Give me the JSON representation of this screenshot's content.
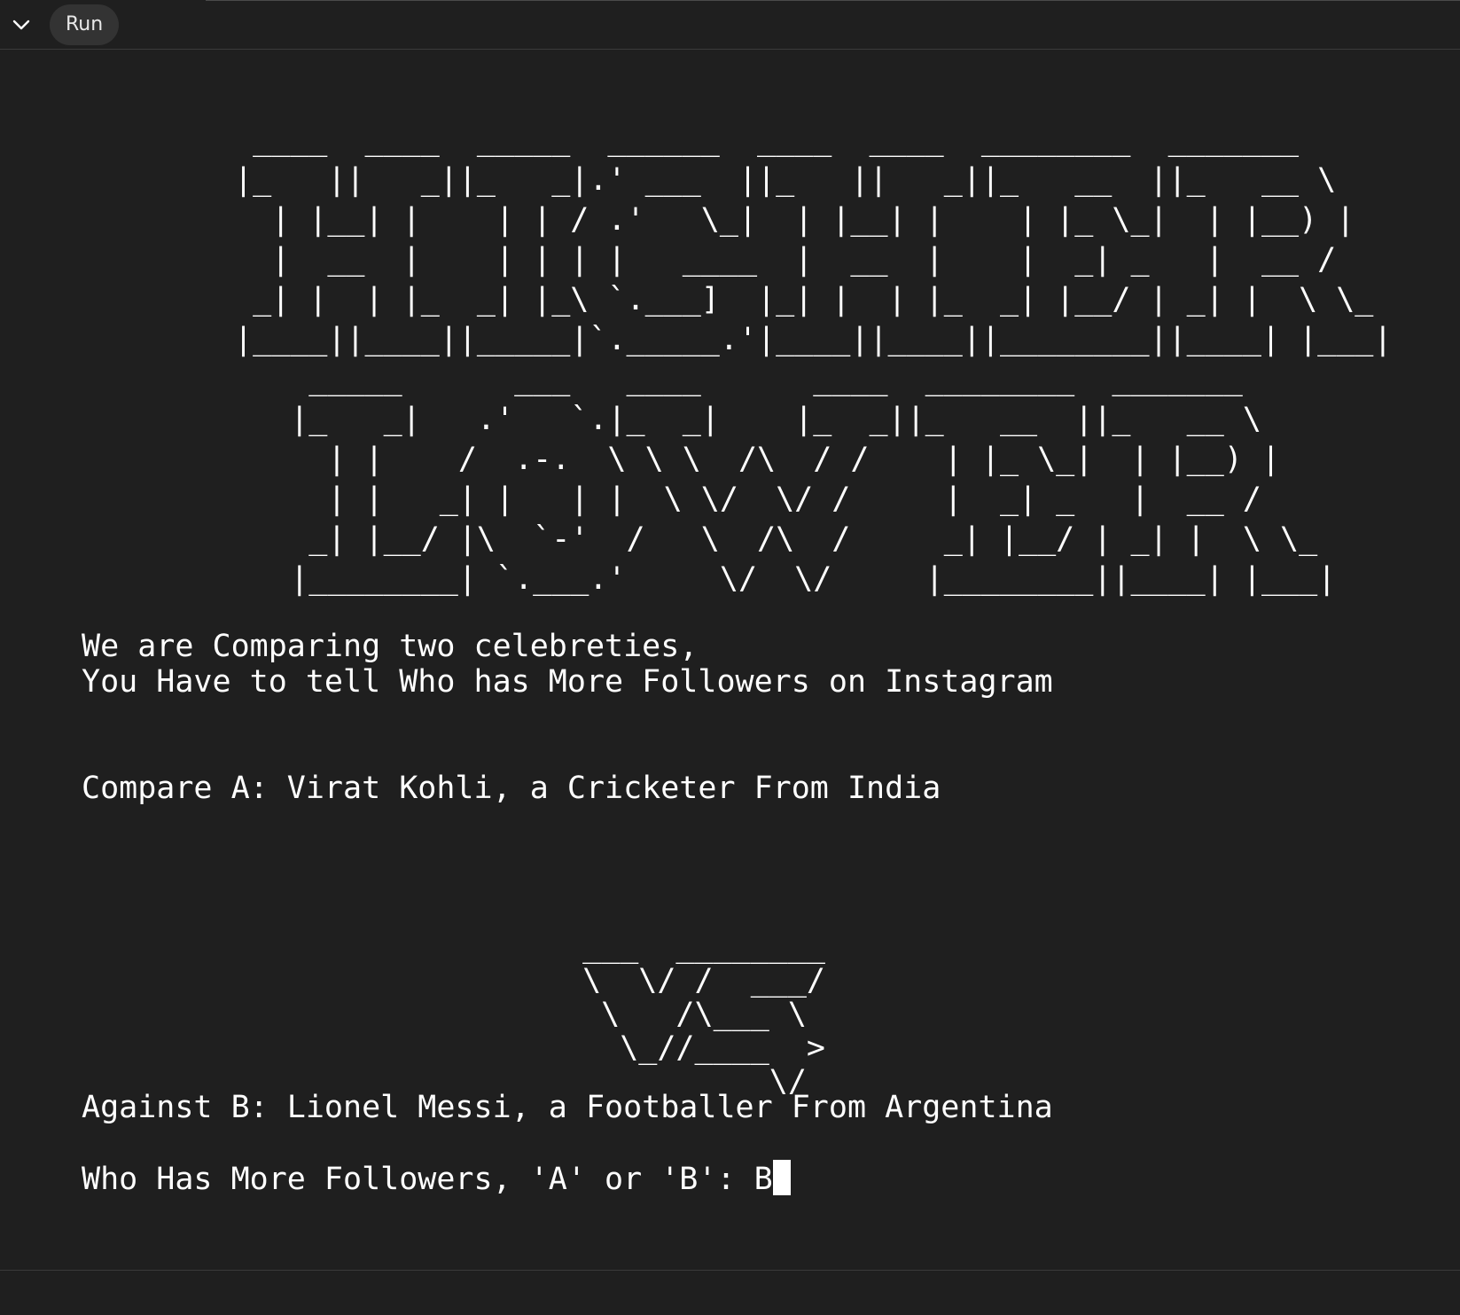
{
  "toolbar": {
    "collapse_icon": "chevron-down-icon",
    "run_label": "Run"
  },
  "console": {
    "ascii_title": " ____  ____  _____  ______  ____  ____  ________  _______\n|_   ||   _||_   _|.' ___  ||_   ||   _||_   __  ||_   __ \\\n  | |__| |    | | / .'   \\_|  | |__| |    | |_ \\_|  | |__) |\n  |  __  |    | | | |   ____  |  __  |    |  _| _   |  __ /\n _| |  | |_  _| |_\\ `.___]  |_| |  | |_  _| |__/ | _| |  \\ \\_\n|____||____||_____|`._____.'|____||____||________||____| |___|\n    _____      ___   ____      ____  ________  _______\n   |_   _|   .'   `.|_  _|    |_  _||_   __  ||_   __ \\\n     | |    /  .-.  \\ \\ \\  /\\  / /    | |_ \\_|  | |__) |\n     | |   _| |   | |  \\ \\/  \\/ /     |  _| _   |  __ /\n    _| |__/ |\\  `-'  /   \\  /\\  /     _| |__/ | _| |  \\ \\_\n   |________| `.___.'     \\/  \\/     |________||____| |___|",
    "intro_line1": "We are Comparing two celebreties,",
    "intro_line2": "You Have to tell Who has More Followers on Instagram",
    "compare_a": "Compare A: Virat Kohli, a Cricketer From India",
    "ascii_vs": " ___  ________\n \\  \\/ /  ___/\n  \\   /\\___ \\\n   \\_//____  >\n           \\/",
    "against_b": "Against B: Lionel Messi, a Footballer From Argentina",
    "prompt": "Who Has More Followers, 'A' or 'B': ",
    "input_value": "B"
  }
}
